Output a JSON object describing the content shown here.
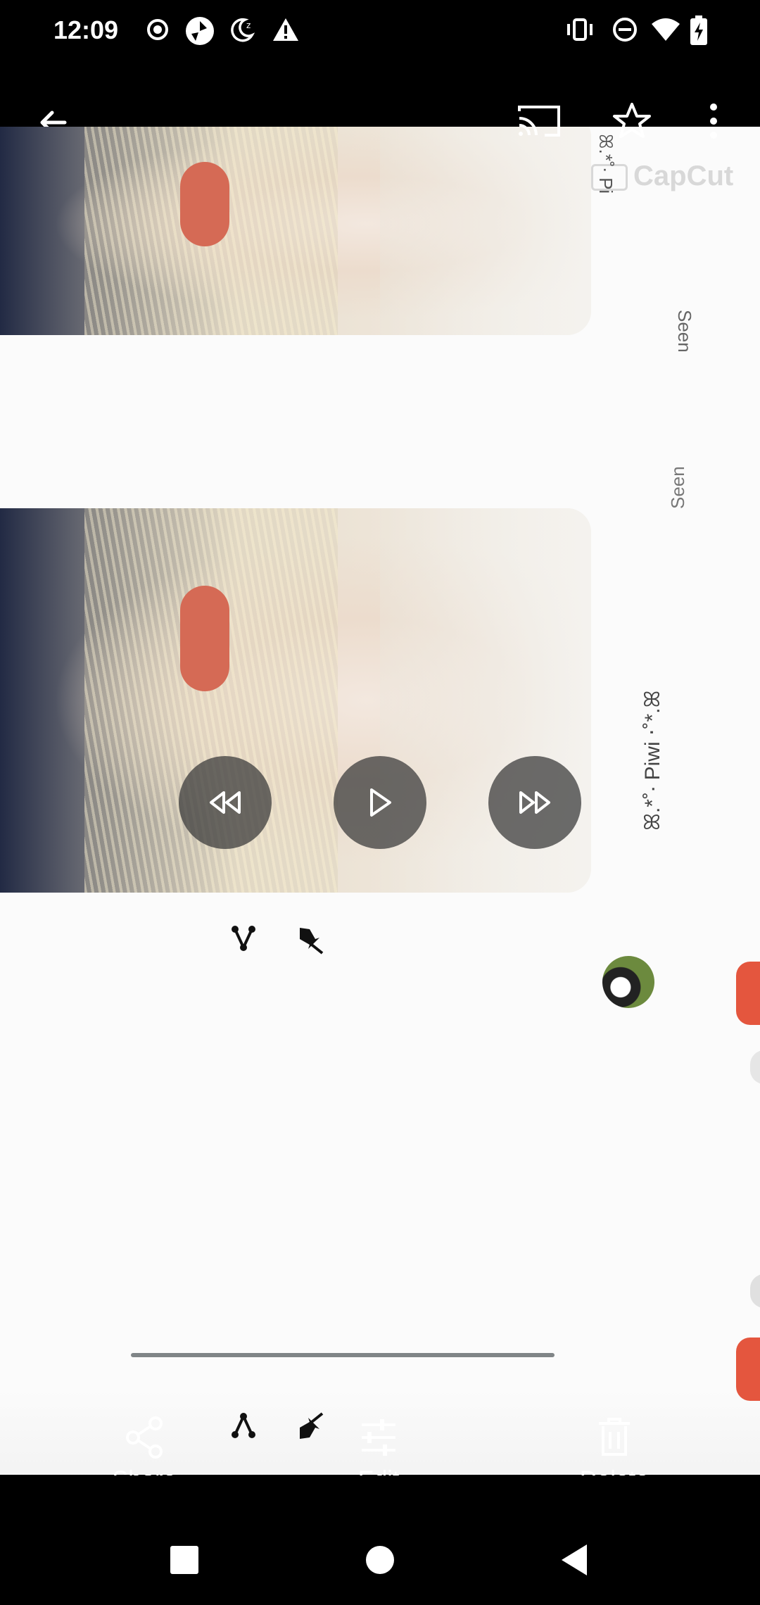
{
  "status_bar": {
    "time": "12:09",
    "left_icons": [
      "location-target-icon",
      "shutter-app-icon",
      "night-mode-icon",
      "warning-icon"
    ],
    "right_icons": [
      "vibrate-icon",
      "do-not-disturb-icon",
      "wifi-icon",
      "battery-charging-icon"
    ]
  },
  "app_bar": {
    "back_icon": "arrow-left-icon",
    "actions": [
      "cast-icon",
      "star-icon",
      "more-vert-icon"
    ]
  },
  "media": {
    "watermark": "CapCut",
    "top_seen_label": "Seen",
    "top_name_fragment": "ꕤ.*˚‧ Pi",
    "bottom_seen_label": "Seen",
    "bottom_name": "ꕤ.*˚‧ Piwi ‧˚*.ꕤ",
    "playback_controls": [
      "rewind-icon",
      "play-icon",
      "fast-forward-icon"
    ]
  },
  "bottom_actions": {
    "share": "Share",
    "edit": "Edit",
    "delete": "Delete"
  },
  "nav_bar": [
    "recents-square-icon",
    "home-circle-icon",
    "back-triangle-icon"
  ]
}
